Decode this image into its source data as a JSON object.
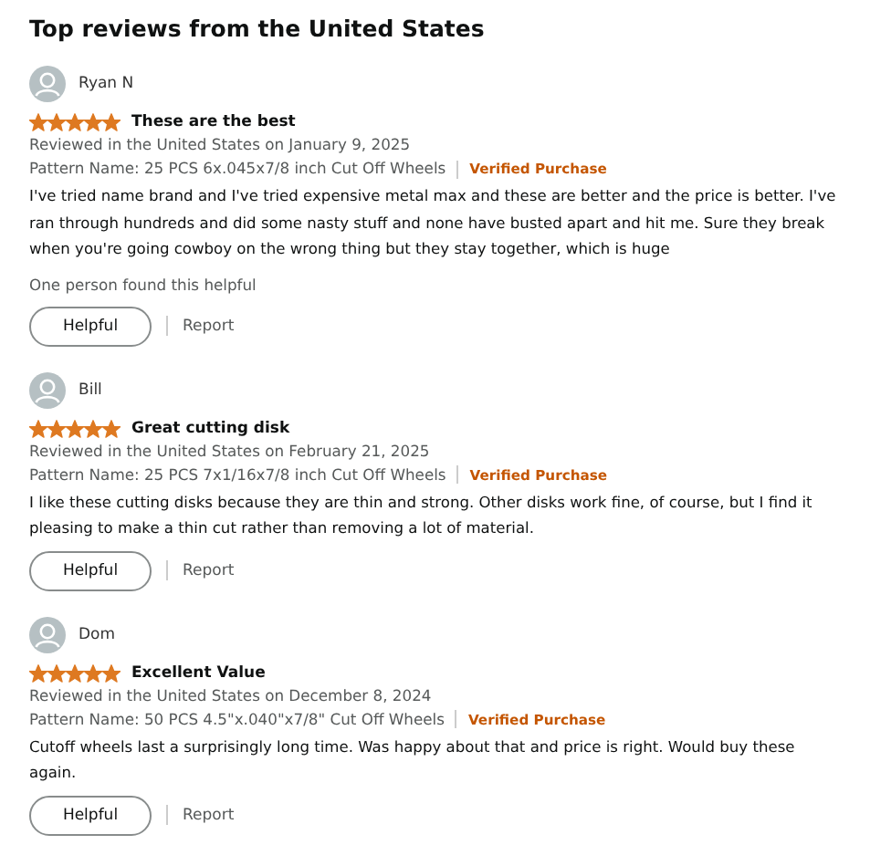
{
  "heading": "Top reviews from the United States",
  "reviews": [
    {
      "author": "Ryan N",
      "stars": 5,
      "title": "These are the best",
      "date": "Reviewed in the United States on January 9, 2025",
      "pattern": "Pattern Name: 25 PCS 6x.045x7/8 inch Cut Off Wheels",
      "verified": "Verified Purchase",
      "body": "I've tried name brand and I've tried expensive metal max and these are better and the price is better. I've ran through hundreds and did some nasty stuff and none have busted apart and hit me. Sure they break when you're going cowboy on the wrong thing but they stay together, which is huge",
      "helpful_count": "One person found this helpful",
      "helpful_button": "Helpful",
      "report": "Report"
    },
    {
      "author": "Bill",
      "stars": 5,
      "title": "Great cutting disk",
      "date": "Reviewed in the United States on February 21, 2025",
      "pattern": "Pattern Name: 25 PCS 7x1/16x7/8 inch Cut Off Wheels",
      "verified": "Verified Purchase",
      "body": "I like these cutting disks because they are thin and strong. Other disks work fine, of course, but I find it pleasing to make a thin cut rather than removing a lot of material.",
      "helpful_button": "Helpful",
      "report": "Report"
    },
    {
      "author": "Dom",
      "stars": 5,
      "title": "Excellent Value",
      "date": "Reviewed in the United States on December 8, 2024",
      "pattern": "Pattern Name: 50 PCS 4.5\"x.040\"x7/8\" Cut Off Wheels",
      "verified": "Verified Purchase",
      "body": "Cutoff wheels last a surprisingly long time. Was happy about that and price is right. Would buy these again.",
      "helpful_button": "Helpful",
      "report": "Report"
    }
  ]
}
